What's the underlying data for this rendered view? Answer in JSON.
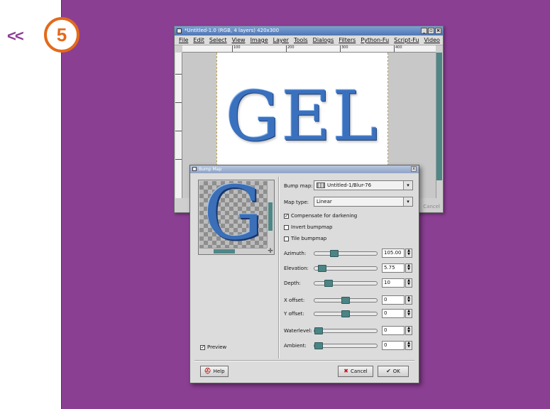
{
  "step": {
    "arrow": "<<",
    "number": "5"
  },
  "image_window": {
    "title": "*Untitled-1.0 (RGB, 4 layers) 420x300",
    "menu": [
      "File",
      "Edit",
      "Select",
      "View",
      "Image",
      "Layer",
      "Tools",
      "Dialogs",
      "Filters",
      "Python-Fu",
      "Script-Fu",
      "Video"
    ],
    "ruler_ticks": [
      "100",
      "200",
      "300",
      "400"
    ],
    "canvas_text": "GEL",
    "ghost_cancel": "Cancel"
  },
  "dialog": {
    "title": "Bump Map",
    "close_label": "x",
    "bump_map_label": "Bump map:",
    "bump_map_value": "Untitled-1/Blur-76",
    "map_type_label": "Map type:",
    "map_type_value": "Linear",
    "compensate_label": "Compensate for darkening",
    "compensate_checked": true,
    "invert_label": "Invert bumpmap",
    "invert_checked": false,
    "tile_label": "Tile bumpmap",
    "tile_checked": false,
    "params": [
      {
        "label": "Azimuth:",
        "value": "105.00",
        "fraction": 0.29
      },
      {
        "label": "Elevation:",
        "value": "5.75",
        "fraction": 0.06
      },
      {
        "label": "Depth:",
        "value": "10",
        "fraction": 0.18
      },
      {
        "label": "X offset:",
        "value": "0",
        "fraction": 0.5
      },
      {
        "label": "Y offset:",
        "value": "0",
        "fraction": 0.5
      },
      {
        "label": "Waterlevel:",
        "value": "0",
        "fraction": 0.0
      },
      {
        "label": "Ambient:",
        "value": "0",
        "fraction": 0.0
      }
    ],
    "preview_label": "Preview",
    "preview_checked": true,
    "preview_glyph": "G",
    "help_label": "Help",
    "cancel_label": "Cancel",
    "ok_label": "OK"
  }
}
